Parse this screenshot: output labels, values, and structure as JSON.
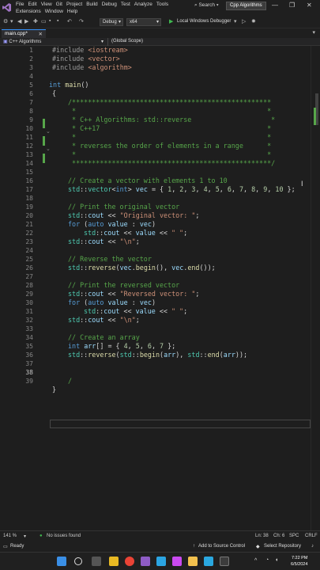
{
  "title_bar": {
    "menu_row1": [
      "File",
      "Edit",
      "View",
      "Git",
      "Project",
      "Build",
      "Debug",
      "Test",
      "Analyze",
      "Tools"
    ],
    "menu_row2": [
      "Extensions",
      "Window",
      "Help"
    ],
    "search_label": "Search",
    "solution_badge": "Cpp Algorithms"
  },
  "toolbar": {
    "config": "Debug",
    "platform": "x64",
    "debugger": "Local Windows Debugger"
  },
  "tabs": [
    {
      "label": "main.cpp*"
    }
  ],
  "nav": {
    "project": "C++ Algorithms",
    "scope": "(Global Scope)"
  },
  "editor": {
    "line_numbers": [
      "1",
      "2",
      "3",
      "4",
      "5",
      "6",
      "7",
      "8",
      "9",
      "10",
      "11",
      "12",
      "13",
      "14",
      "15",
      "16",
      "17",
      "18",
      "19",
      "20",
      "21",
      "22",
      "23",
      "24",
      "25",
      "26",
      "27",
      "28",
      "29",
      "30",
      "31",
      "32",
      "33",
      "34",
      "35",
      "36",
      "37",
      "38",
      "39"
    ],
    "current_line": "38"
  },
  "bottom": {
    "zoom": "141 %",
    "issues": "No issues found",
    "ln": "Ln: 38",
    "ch": "Ch: 6",
    "ws": "SPC",
    "eol": "CRLF"
  },
  "status": {
    "ready": "Ready",
    "source_control": "Add to Source Control",
    "repo": "Select Repository"
  },
  "taskbar": {
    "time": "7:22 PM",
    "date": "6/5/2024"
  },
  "colors": {
    "keyword": "#569cd6",
    "string": "#ce9178",
    "comment": "#57a64a",
    "type": "#4ec9b0",
    "function": "#dcdcaa",
    "number": "#b5cea8",
    "accent": "#3794ff"
  }
}
